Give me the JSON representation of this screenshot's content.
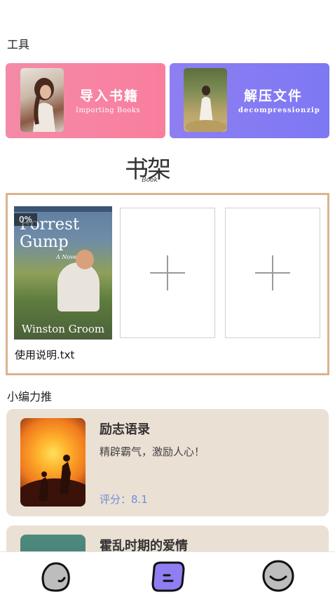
{
  "tools": {
    "section_title": "工具",
    "import": {
      "title": "导入书籍",
      "subtitle": "Importing Books",
      "gradient": [
        "#f48aa6",
        "#f97e9e"
      ]
    },
    "unzip": {
      "title": "解压文件",
      "subtitle": "decompressionzip",
      "gradient": [
        "#8e7ef2",
        "#7d78f3"
      ]
    }
  },
  "shelf_logo": {
    "main": "书架",
    "sub": "Book"
  },
  "bookshelf": {
    "border_color": "#d9b48e",
    "book": {
      "progress": "0%",
      "cover_title": "Forrest Gump",
      "cover_subtitle": "A Novel",
      "cover_author": "Winston Groom",
      "name": "使用说明.txt"
    },
    "empty_slots": 2
  },
  "recommend": {
    "section_title": "小编力推",
    "items": [
      {
        "title": "励志语录",
        "desc": "精辟霸气，激励人心！",
        "score": "评分：8.1"
      },
      {
        "title": "霍乱时期的爱情",
        "desc": "",
        "score": ""
      }
    ],
    "card_color": "#ebe0d4",
    "score_color": "#6f8ed8"
  },
  "nav": {
    "items": [
      {
        "icon": "bookshelf-face-icon",
        "color": "#bdbdbd"
      },
      {
        "icon": "chat-face-icon",
        "color": "#8e7ef2"
      },
      {
        "icon": "profile-face-icon",
        "color": "#bdbdbd"
      }
    ]
  }
}
